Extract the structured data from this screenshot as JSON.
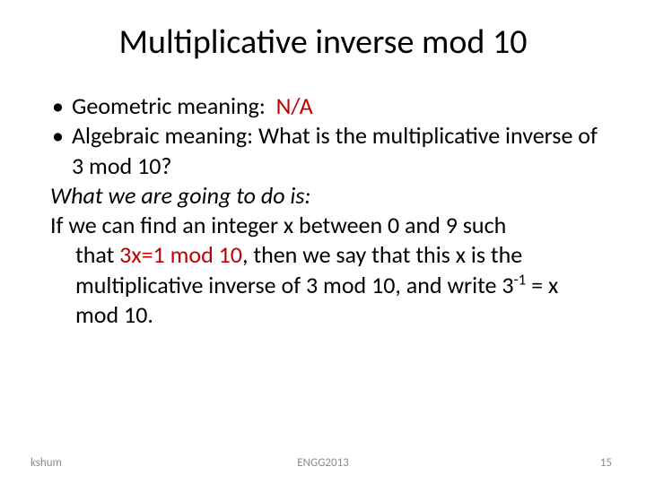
{
  "title": "Multiplicative inverse mod 10",
  "bullets": [
    {
      "label": "Geometric meaning:",
      "value": "N/A"
    },
    {
      "label": "Algebraic meaning:",
      "value": "What is the multiplicative inverse of 3 mod 10?"
    }
  ],
  "line_intro": "What we are going to do is:",
  "para": {
    "p1": "If we can find an integer x between 0 and 9 such",
    "p2a": "that ",
    "eq": "3x=1 mod 10",
    "p2b": ", then we say that this x is the multiplicative inverse of 3 mod 10, and write 3",
    "sup": "-1",
    "p2c": " = x mod 10."
  },
  "footer": {
    "left": "kshum",
    "center": "ENGG2013",
    "right": "15"
  }
}
